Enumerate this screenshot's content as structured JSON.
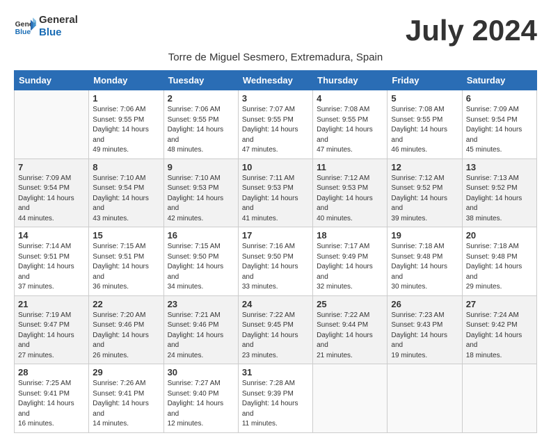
{
  "header": {
    "logo_line1": "General",
    "logo_line2": "Blue",
    "month_title": "July 2024",
    "subtitle": "Torre de Miguel Sesmero, Extremadura, Spain"
  },
  "days_of_week": [
    "Sunday",
    "Monday",
    "Tuesday",
    "Wednesday",
    "Thursday",
    "Friday",
    "Saturday"
  ],
  "weeks": [
    [
      {
        "day": "",
        "sunrise": "",
        "sunset": "",
        "daylight": ""
      },
      {
        "day": "1",
        "sunrise": "7:06 AM",
        "sunset": "9:55 PM",
        "daylight": "14 hours and 49 minutes."
      },
      {
        "day": "2",
        "sunrise": "7:06 AM",
        "sunset": "9:55 PM",
        "daylight": "14 hours and 48 minutes."
      },
      {
        "day": "3",
        "sunrise": "7:07 AM",
        "sunset": "9:55 PM",
        "daylight": "14 hours and 47 minutes."
      },
      {
        "day": "4",
        "sunrise": "7:08 AM",
        "sunset": "9:55 PM",
        "daylight": "14 hours and 47 minutes."
      },
      {
        "day": "5",
        "sunrise": "7:08 AM",
        "sunset": "9:55 PM",
        "daylight": "14 hours and 46 minutes."
      },
      {
        "day": "6",
        "sunrise": "7:09 AM",
        "sunset": "9:54 PM",
        "daylight": "14 hours and 45 minutes."
      }
    ],
    [
      {
        "day": "7",
        "sunrise": "7:09 AM",
        "sunset": "9:54 PM",
        "daylight": "14 hours and 44 minutes."
      },
      {
        "day": "8",
        "sunrise": "7:10 AM",
        "sunset": "9:54 PM",
        "daylight": "14 hours and 43 minutes."
      },
      {
        "day": "9",
        "sunrise": "7:10 AM",
        "sunset": "9:53 PM",
        "daylight": "14 hours and 42 minutes."
      },
      {
        "day": "10",
        "sunrise": "7:11 AM",
        "sunset": "9:53 PM",
        "daylight": "14 hours and 41 minutes."
      },
      {
        "day": "11",
        "sunrise": "7:12 AM",
        "sunset": "9:53 PM",
        "daylight": "14 hours and 40 minutes."
      },
      {
        "day": "12",
        "sunrise": "7:12 AM",
        "sunset": "9:52 PM",
        "daylight": "14 hours and 39 minutes."
      },
      {
        "day": "13",
        "sunrise": "7:13 AM",
        "sunset": "9:52 PM",
        "daylight": "14 hours and 38 minutes."
      }
    ],
    [
      {
        "day": "14",
        "sunrise": "7:14 AM",
        "sunset": "9:51 PM",
        "daylight": "14 hours and 37 minutes."
      },
      {
        "day": "15",
        "sunrise": "7:15 AM",
        "sunset": "9:51 PM",
        "daylight": "14 hours and 36 minutes."
      },
      {
        "day": "16",
        "sunrise": "7:15 AM",
        "sunset": "9:50 PM",
        "daylight": "14 hours and 34 minutes."
      },
      {
        "day": "17",
        "sunrise": "7:16 AM",
        "sunset": "9:50 PM",
        "daylight": "14 hours and 33 minutes."
      },
      {
        "day": "18",
        "sunrise": "7:17 AM",
        "sunset": "9:49 PM",
        "daylight": "14 hours and 32 minutes."
      },
      {
        "day": "19",
        "sunrise": "7:18 AM",
        "sunset": "9:48 PM",
        "daylight": "14 hours and 30 minutes."
      },
      {
        "day": "20",
        "sunrise": "7:18 AM",
        "sunset": "9:48 PM",
        "daylight": "14 hours and 29 minutes."
      }
    ],
    [
      {
        "day": "21",
        "sunrise": "7:19 AM",
        "sunset": "9:47 PM",
        "daylight": "14 hours and 27 minutes."
      },
      {
        "day": "22",
        "sunrise": "7:20 AM",
        "sunset": "9:46 PM",
        "daylight": "14 hours and 26 minutes."
      },
      {
        "day": "23",
        "sunrise": "7:21 AM",
        "sunset": "9:46 PM",
        "daylight": "14 hours and 24 minutes."
      },
      {
        "day": "24",
        "sunrise": "7:22 AM",
        "sunset": "9:45 PM",
        "daylight": "14 hours and 23 minutes."
      },
      {
        "day": "25",
        "sunrise": "7:22 AM",
        "sunset": "9:44 PM",
        "daylight": "14 hours and 21 minutes."
      },
      {
        "day": "26",
        "sunrise": "7:23 AM",
        "sunset": "9:43 PM",
        "daylight": "14 hours and 19 minutes."
      },
      {
        "day": "27",
        "sunrise": "7:24 AM",
        "sunset": "9:42 PM",
        "daylight": "14 hours and 18 minutes."
      }
    ],
    [
      {
        "day": "28",
        "sunrise": "7:25 AM",
        "sunset": "9:41 PM",
        "daylight": "14 hours and 16 minutes."
      },
      {
        "day": "29",
        "sunrise": "7:26 AM",
        "sunset": "9:41 PM",
        "daylight": "14 hours and 14 minutes."
      },
      {
        "day": "30",
        "sunrise": "7:27 AM",
        "sunset": "9:40 PM",
        "daylight": "14 hours and 12 minutes."
      },
      {
        "day": "31",
        "sunrise": "7:28 AM",
        "sunset": "9:39 PM",
        "daylight": "14 hours and 11 minutes."
      },
      {
        "day": "",
        "sunrise": "",
        "sunset": "",
        "daylight": ""
      },
      {
        "day": "",
        "sunrise": "",
        "sunset": "",
        "daylight": ""
      },
      {
        "day": "",
        "sunrise": "",
        "sunset": "",
        "daylight": ""
      }
    ]
  ]
}
